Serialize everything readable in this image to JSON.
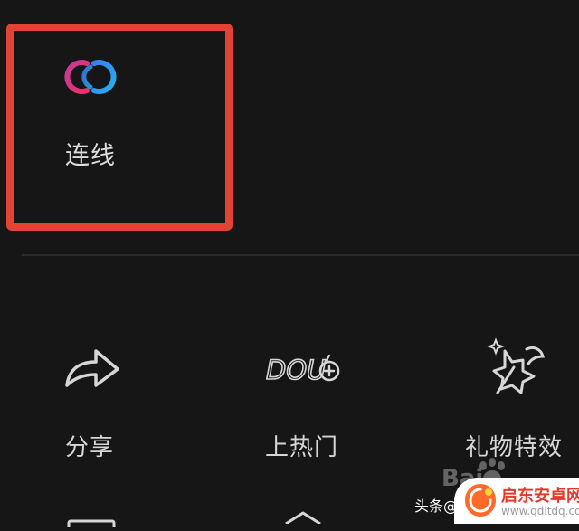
{
  "top_feature": {
    "label": "连线",
    "icon": "link-rings-icon"
  },
  "actions": [
    {
      "label": "分享",
      "icon": "share-arrow-icon"
    },
    {
      "label": "上热门",
      "icon": "dou-plus-icon",
      "icon_text": "DOU"
    },
    {
      "label": "礼物特效",
      "icon": "gift-effect-icon"
    }
  ],
  "watermark": {
    "brand_text": "Bai",
    "handle_text": "头条@",
    "site_title": "启东安卓网",
    "site_url": "www.qdltdq.com"
  },
  "colors": {
    "background": "#161616",
    "highlight": "#e34335",
    "text": "#d9d9d9",
    "ring_pink": "#e8336e",
    "ring_blue": "#2f8cf0"
  }
}
